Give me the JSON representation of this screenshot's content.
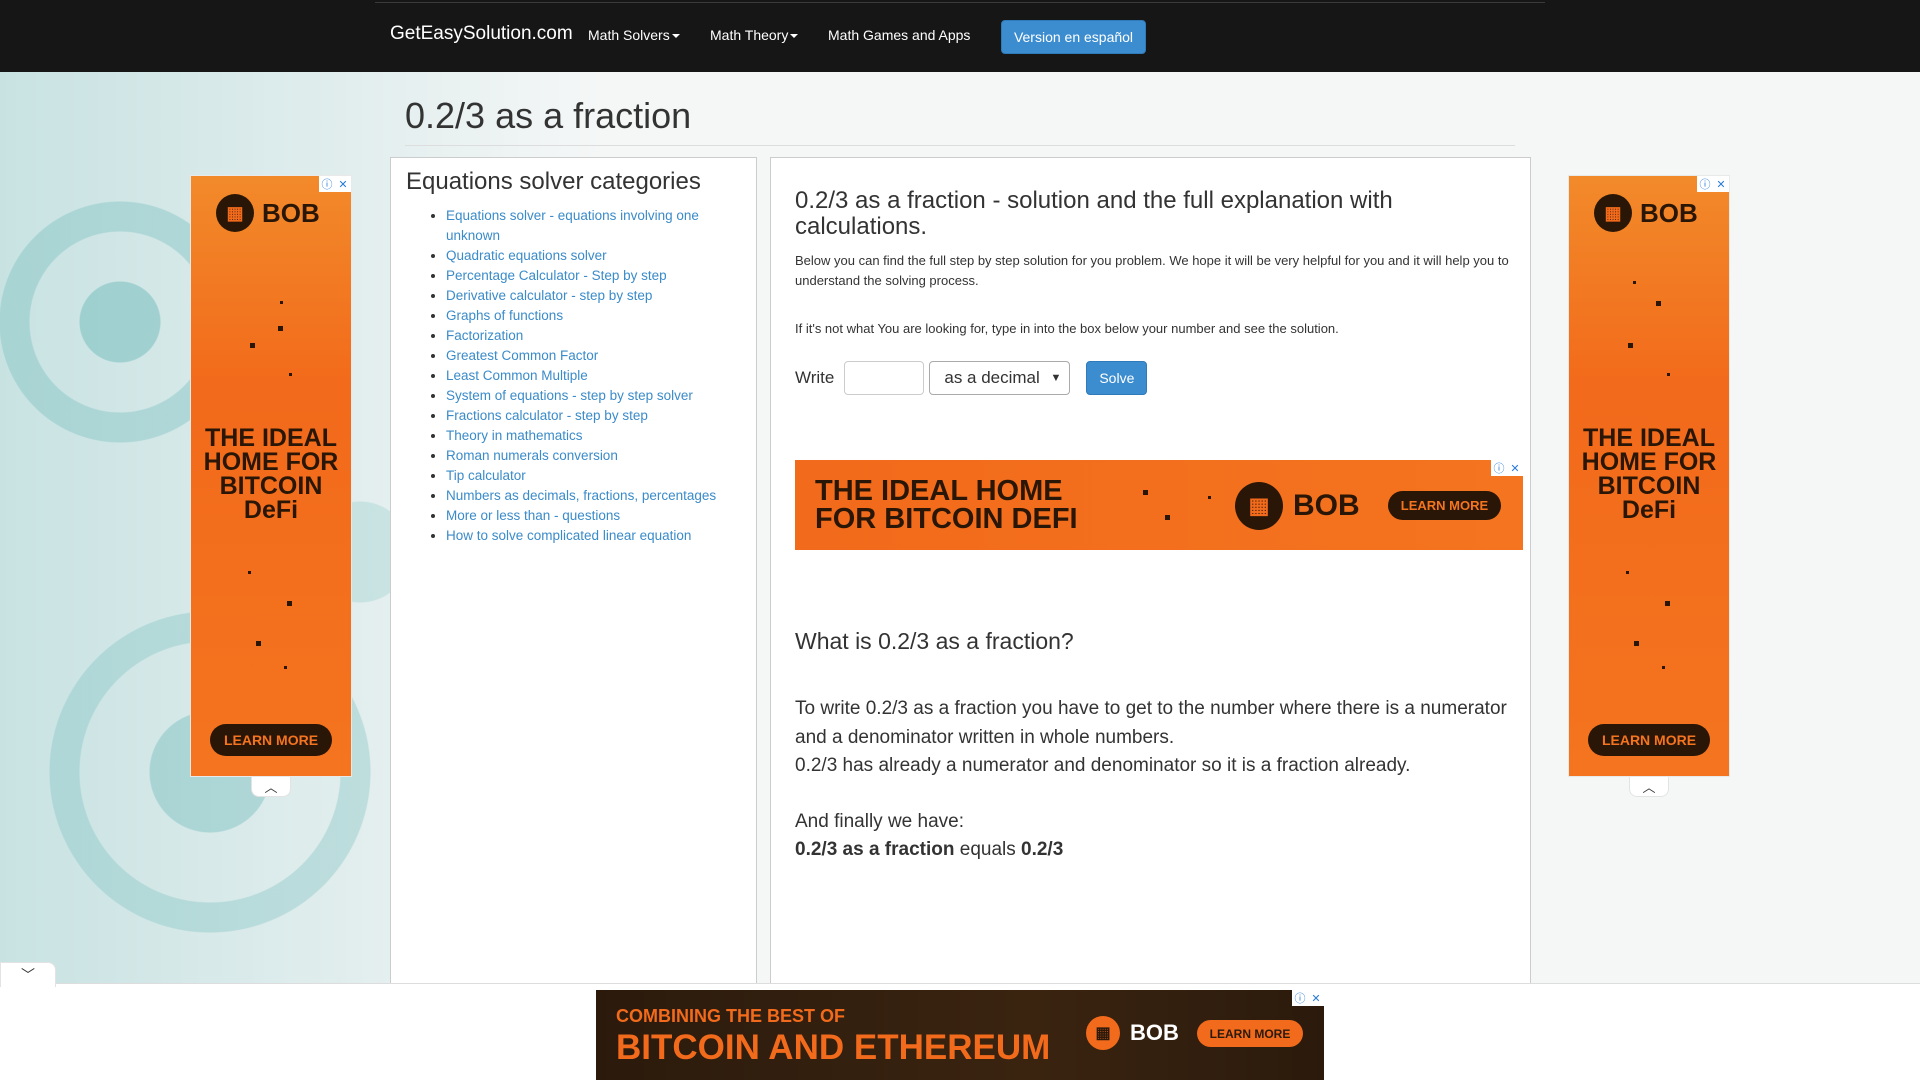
{
  "navbar": {
    "brand": "GetEasySolution.com",
    "items": [
      {
        "label": "Math Solvers",
        "dropdown": true
      },
      {
        "label": "Math Theory",
        "dropdown": true
      },
      {
        "label": "Math Games and Apps",
        "dropdown": false
      }
    ],
    "spanish_button": "Version en español"
  },
  "page": {
    "title": "0.2/3 as a fraction"
  },
  "sidebar": {
    "heading": "Equations solver categories",
    "items": [
      "Equations solver - equations involving one unknown",
      "Quadratic equations solver",
      "Percentage Calculator - Step by step",
      "Derivative calculator - step by step",
      "Graphs of functions",
      "Factorization",
      "Greatest Common Factor",
      "Least Common Multiple",
      "System of equations - step by step solver",
      "Fractions calculator - step by step",
      "Theory in mathematics",
      "Roman numerals conversion",
      "Tip calculator",
      "Numbers as decimals, fractions, percentages",
      "More or less than - questions",
      "How to solve complicated linear equation"
    ]
  },
  "main": {
    "heading": "0.2/3 as a fraction - solution and the full explanation with calculations.",
    "intro": "Below you can find the full step by step solution for you problem. We hope it will be very helpful for you and it will help you to understand the solving process.",
    "hint": "If it's not what You are looking for, type in into the box below your number and see the solution.",
    "form": {
      "label": "Write",
      "input_value": "",
      "select_value": "as a decimal",
      "button": "Solve"
    },
    "question": "What is 0.2/3 as a fraction?",
    "explanation_1": "To write 0.2/3 as a fraction you have to get to the number where there is a numerator and a denominator written in whole numbers.",
    "explanation_2": "0.2/3 has already a numerator and denominator so it is a fraction already.",
    "finally": "And finally we have:",
    "result_bold_1": "0.2/3 as a fraction",
    "result_equals": " equals ",
    "result_bold_2": "0.2/3"
  },
  "ads": {
    "brand": "BOB",
    "side_tagline": "THE IDEAL HOME FOR BITCOIN DeFi",
    "banner_line1": "THE IDEAL HOME",
    "banner_line2": "FOR BITCOIN DEFI",
    "learn_more": "LEARN MORE",
    "bottom_line1": "COMBINING THE BEST OF",
    "bottom_line2": "BITCOIN AND ETHEREUM",
    "accent": "#f26a1b",
    "dark": "#2a1606"
  }
}
